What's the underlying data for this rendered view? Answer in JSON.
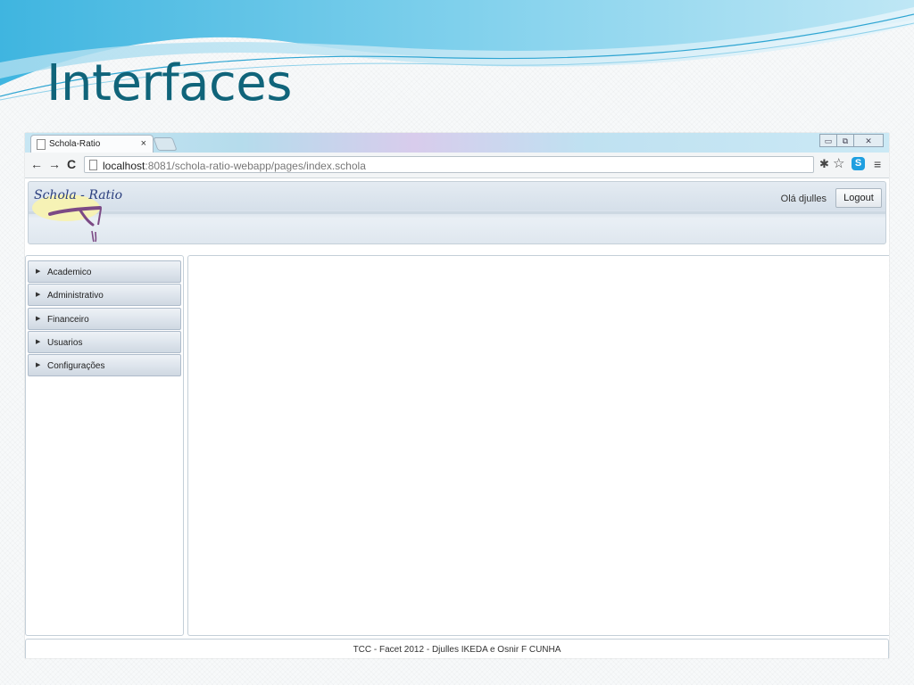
{
  "slide": {
    "title": "Interfaces"
  },
  "browser": {
    "tab_title": "Schola-Ratio",
    "tab_close": "×",
    "url_host": "localhost",
    "url_path": ":8081/schola-ratio-webapp/pages/index.schola",
    "window_buttons": [
      "▭",
      "⧉",
      "✕"
    ]
  },
  "app": {
    "logo_text": "Schola - Ratio",
    "greeting": "Olá djulles",
    "logout_label": "Logout",
    "menu": [
      {
        "label": "Academico"
      },
      {
        "label": "Administrativo"
      },
      {
        "label": "Financeiro"
      },
      {
        "label": "Usuarios"
      },
      {
        "label": "Configurações"
      }
    ],
    "footer": "TCC - Facet 2012 - Djulles IKEDA e Osnir F CUNHA"
  },
  "colors": {
    "title": "#10647a",
    "skype": "#1f9fe0",
    "menu_border": "#aebccb"
  },
  "icons": {
    "back": "←",
    "forward": "→",
    "reload": "C",
    "extension": "✱",
    "bookmark": "☆",
    "skype": "S",
    "menu": "≡",
    "menu_arrow": "▶"
  }
}
